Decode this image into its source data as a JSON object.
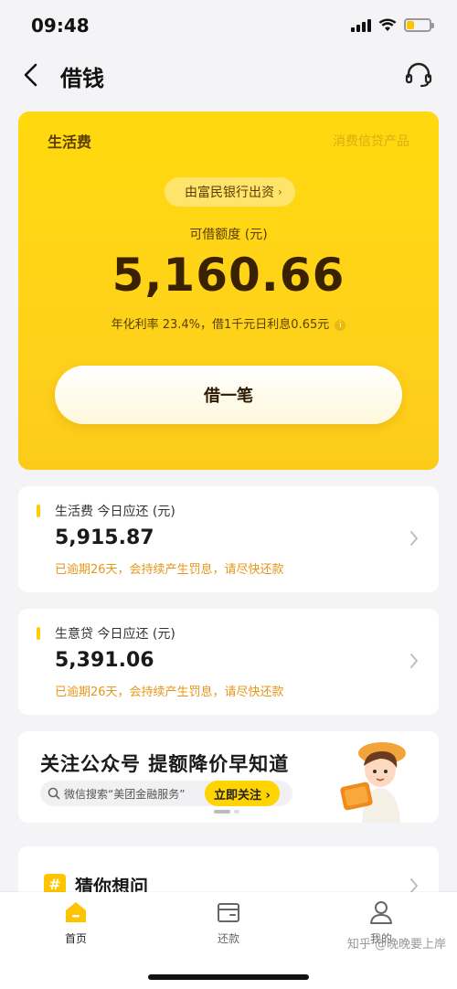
{
  "status_bar": {
    "time": "09:48"
  },
  "header": {
    "title": "借钱",
    "back_icon": "chevron-left-icon",
    "service_icon": "headset-icon"
  },
  "loan_card": {
    "product_name": "生活费",
    "product_tag": "消费信贷产品",
    "lender": "由富民银行出资",
    "limit_label": "可借额度 (元)",
    "limit_amount": "5,160.66",
    "rate_text": "年化利率 23.4%，借1千元日利息0.65元",
    "borrow_button": "借一笔",
    "accent_color": "#ffd90e"
  },
  "repayments": [
    {
      "title": "生活费 今日应还 (元)",
      "amount": "5,915.87",
      "warning": "已逾期26天，会持续产生罚息，请尽快还款"
    },
    {
      "title": "生意贷 今日应还 (元)",
      "amount": "5,391.06",
      "warning": "已逾期26天，会持续产生罚息，请尽快还款"
    }
  ],
  "banner": {
    "title": "关注公众号 提额降价早知道",
    "search_hint": "微信搜索“美团金融服务”",
    "follow_button": "立即关注 ›"
  },
  "guess": {
    "icon_text": "#",
    "title": "猜你想问"
  },
  "tabs": [
    {
      "label": "首页",
      "icon": "home-icon",
      "active": true
    },
    {
      "label": "还款",
      "icon": "wallet-icon",
      "active": false
    },
    {
      "label": "我的",
      "icon": "profile-icon",
      "active": false
    }
  ],
  "watermark": "知乎 @晚晚要上岸"
}
